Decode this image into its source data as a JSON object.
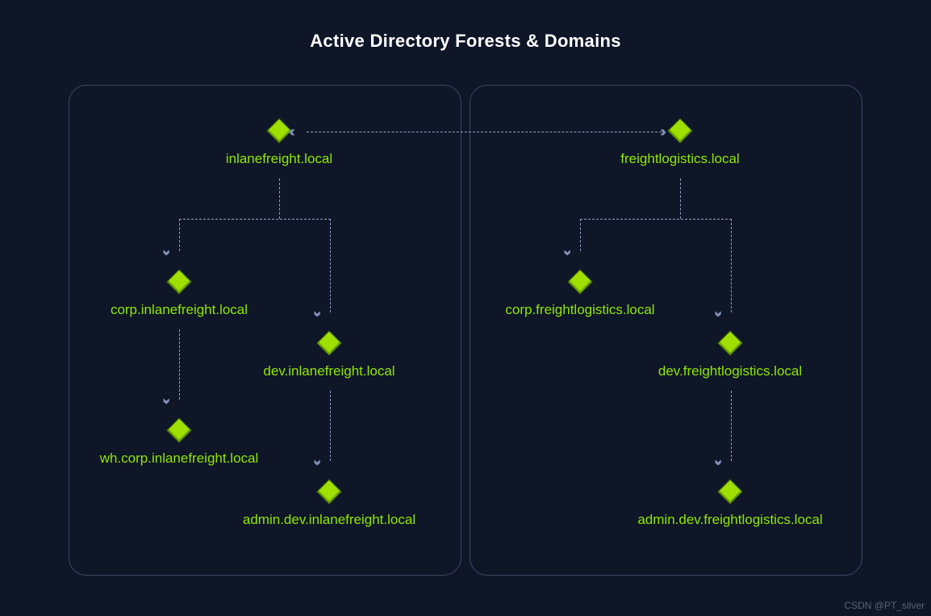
{
  "title": "Active Directory Forests & Domains",
  "watermark": "CSDN @PT_silver",
  "forests": {
    "left": {
      "root": "inlanefreight.local",
      "corp": "corp.inlanefreight.local",
      "dev": "dev.inlanefreight.local",
      "wh": "wh.corp.inlanefreight.local",
      "admin": "admin.dev.inlanefreight.local"
    },
    "right": {
      "root": "freightlogistics.local",
      "corp": "corp.freightlogistics.local",
      "dev": "dev.freightlogistics.local",
      "admin": "admin.dev.freightlogistics.local"
    }
  }
}
